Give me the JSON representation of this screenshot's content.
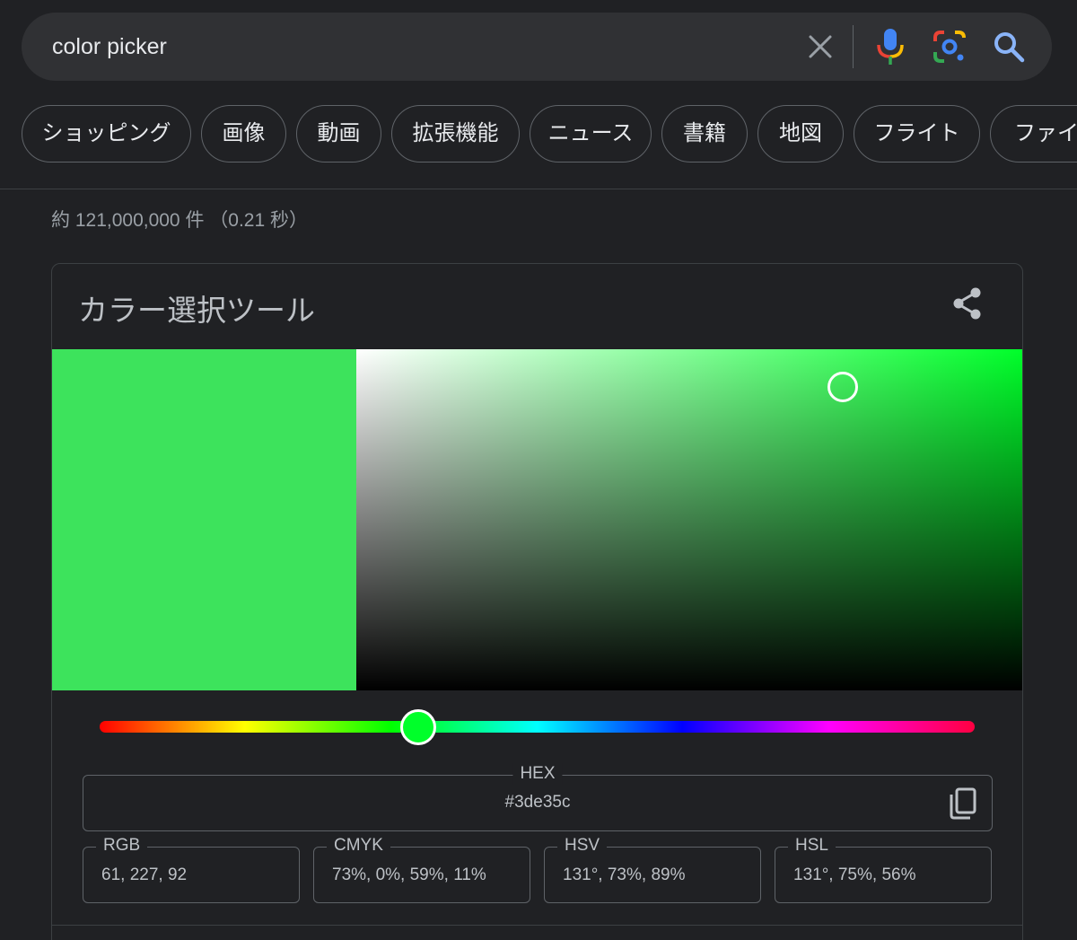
{
  "search": {
    "query": "color picker"
  },
  "chips": [
    {
      "label": "ショッピング"
    },
    {
      "label": "画像"
    },
    {
      "label": "動画"
    },
    {
      "label": "拡張機能"
    },
    {
      "label": "ニュース"
    },
    {
      "label": "書籍"
    },
    {
      "label": "地図"
    },
    {
      "label": "フライト"
    },
    {
      "label": "ファイナンス"
    }
  ],
  "result_stats": "約 121,000,000 件 （0.21 秒）",
  "picker": {
    "title": "カラー選択ツール",
    "selected_color": "#3de35c",
    "hue_color": "#00ff2a",
    "hue_degrees": 131,
    "saturation": 0.73,
    "value": 0.89,
    "hex_legend": "HEX",
    "hex_value": "#3de35c",
    "formats": [
      {
        "legend": "RGB",
        "value": "61, 227, 92"
      },
      {
        "legend": "CMYK",
        "value": "73%, 0%, 59%, 11%"
      },
      {
        "legend": "HSV",
        "value": "131°, 73%, 89%"
      },
      {
        "legend": "HSL",
        "value": "131°, 75%, 56%"
      }
    ]
  },
  "icons": {
    "clear": "close-icon",
    "mic": "microphone-icon",
    "lens": "google-lens-icon",
    "search": "search-icon",
    "share": "share-icon",
    "copy": "copy-icon"
  }
}
